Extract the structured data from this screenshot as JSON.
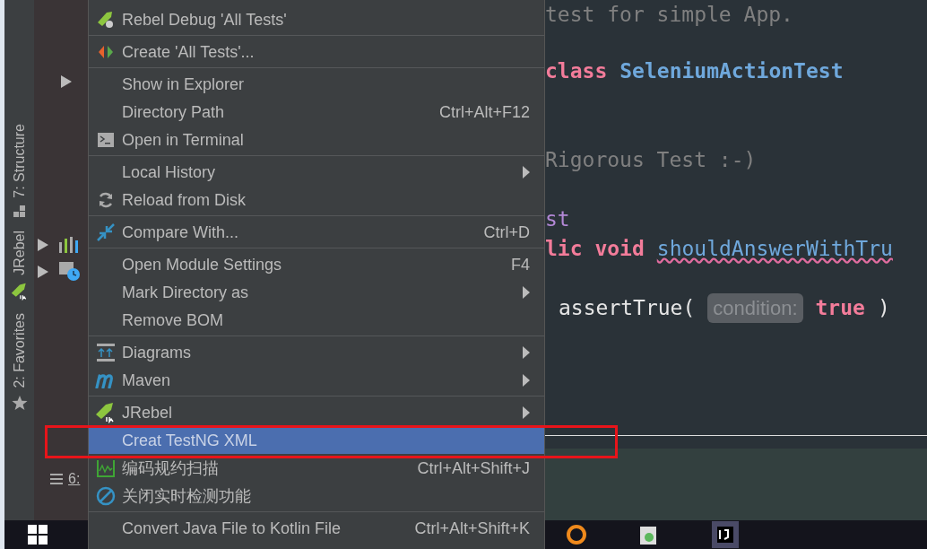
{
  "tool_strip": [
    {
      "label": "7: Structure",
      "kind": "structure"
    },
    {
      "label": "JRebel",
      "kind": "jrebel"
    },
    {
      "label": "2: Favorites",
      "kind": "favorites"
    }
  ],
  "project_panel": {
    "bottom_tab": "6:"
  },
  "context_menu": {
    "items": [
      {
        "label": "Rebel Debug 'All Tests'",
        "kind": "rebeldebug",
        "submenu": false,
        "selected": false,
        "separator_after": true
      },
      {
        "label": "Create 'All Tests'...",
        "kind": "create",
        "submenu": false,
        "selected": false,
        "separator_after": true
      },
      {
        "label": "Show in Explorer",
        "kind": "plain",
        "submenu": false,
        "selected": false,
        "separator_after": false
      },
      {
        "label": "Directory Path",
        "kind": "plain",
        "shortcut": "Ctrl+Alt+F12",
        "submenu": false,
        "selected": false,
        "separator_after": false
      },
      {
        "label": "Open in Terminal",
        "kind": "terminal",
        "submenu": false,
        "selected": false,
        "separator_after": true
      },
      {
        "label": "Local History",
        "kind": "plain",
        "submenu": true,
        "selected": false,
        "separator_after": false
      },
      {
        "label": "Reload from Disk",
        "kind": "reload",
        "submenu": false,
        "selected": false,
        "separator_after": true
      },
      {
        "label": "Compare With...",
        "kind": "compare",
        "shortcut": "Ctrl+D",
        "submenu": false,
        "selected": false,
        "separator_after": true
      },
      {
        "label": "Open Module Settings",
        "kind": "plain",
        "shortcut": "F4",
        "submenu": false,
        "selected": false,
        "separator_after": false
      },
      {
        "label": "Mark Directory as",
        "kind": "plain",
        "submenu": true,
        "selected": false,
        "separator_after": false
      },
      {
        "label": "Remove BOM",
        "kind": "plain",
        "submenu": false,
        "selected": false,
        "separator_after": true
      },
      {
        "label": "Diagrams",
        "kind": "diagrams",
        "submenu": true,
        "selected": false,
        "separator_after": false
      },
      {
        "label": "Maven",
        "kind": "maven",
        "submenu": true,
        "selected": false,
        "separator_after": true
      },
      {
        "label": "JRebel",
        "kind": "jrebel",
        "submenu": true,
        "selected": false,
        "separator_after": false
      },
      {
        "label": "Creat TestNG XML",
        "kind": "plain",
        "submenu": false,
        "selected": true,
        "separator_after": false
      },
      {
        "label": "编码规约扫描",
        "kind": "codescan",
        "shortcut": "Ctrl+Alt+Shift+J",
        "submenu": false,
        "selected": false,
        "separator_after": false
      },
      {
        "label": "关闭实时检测功能",
        "kind": "disable",
        "submenu": false,
        "selected": false,
        "separator_after": true
      },
      {
        "label": "Convert Java File to Kotlin File",
        "kind": "plain",
        "shortcut": "Ctrl+Alt+Shift+K",
        "submenu": false,
        "selected": false,
        "separator_after": false
      }
    ]
  },
  "editor": {
    "lines": [
      {
        "segments": [
          {
            "text": "test for simple App.",
            "kind": "comment"
          }
        ]
      },
      {
        "segments": [
          {
            "text": "class",
            "kind": "keyword"
          },
          {
            "text": "SeleniumActionTest",
            "kind": "type"
          }
        ]
      },
      {
        "segments": [
          {
            "text": "Rigorous Test :-)",
            "kind": "comment"
          }
        ]
      },
      {
        "segments": [
          {
            "text": "st",
            "kind": "annotation"
          }
        ]
      },
      {
        "segments": [
          {
            "text": "lic void",
            "kind": "keyword"
          },
          {
            "text": "shouldAnswerWithTru",
            "kind": "method"
          }
        ]
      },
      {
        "segments": [
          {
            "text": "assertTrue(",
            "kind": "plain"
          },
          {
            "text": "condition:",
            "kind": "hint"
          },
          {
            "text": "true",
            "kind": "keyword"
          },
          {
            "text": ")",
            "kind": "plain"
          }
        ]
      }
    ]
  }
}
